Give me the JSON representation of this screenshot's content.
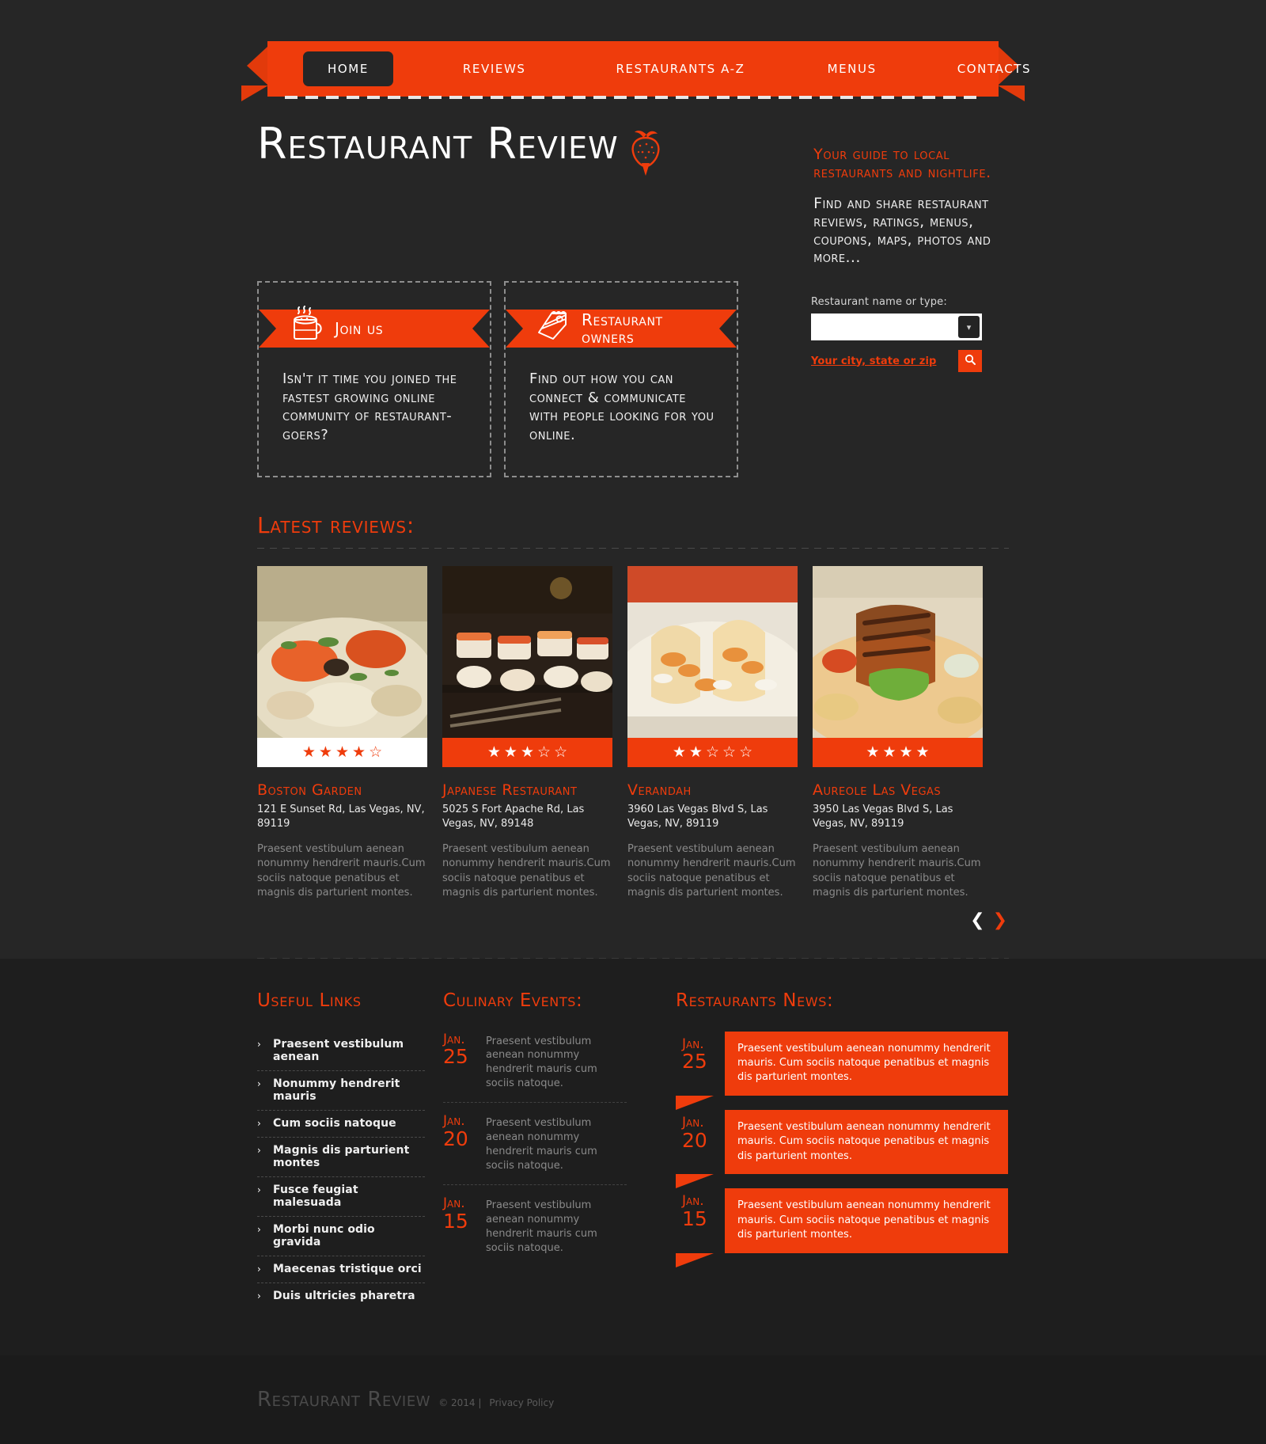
{
  "nav": {
    "items": [
      {
        "label": "HOME",
        "active": true
      },
      {
        "label": "REVIEWS",
        "active": false
      },
      {
        "label": "RESTAURANTS A-Z",
        "active": false
      },
      {
        "label": "MENUS",
        "active": false
      },
      {
        "label": "CONTACTS",
        "active": false
      }
    ]
  },
  "header": {
    "logo": "Restaurant Review",
    "logo_icon": "strawberry-icon",
    "tagline_orange": "Your guide to local restaurants and nightlife.",
    "tagline_white": "Find and share restaurant reviews, ratings, menus, coupons, maps, photos and more..."
  },
  "promos": [
    {
      "icon": "coffee-cup-icon",
      "ribbon_label": "Join us",
      "body": "Isn't it time you joined the fastest growing online community of restaurant-goers?"
    },
    {
      "icon": "cake-slice-icon",
      "ribbon_label": "Restaurant owners",
      "body": "Find out how you can connect & communicate with people looking for you online."
    }
  ],
  "search": {
    "label": "Restaurant name or type:",
    "value": "",
    "placeholder": "",
    "dropdown_icon": "chevron-down-icon",
    "city_link": "Your city, state or zip",
    "submit_icon": "search-icon"
  },
  "reviews": {
    "title": "Latest reviews:",
    "cards": [
      {
        "image": "pasta-seafood-photo",
        "rating_style": "light",
        "rating_filled": 4,
        "rating_total": 5,
        "name": "Boston Garden",
        "address": "121 E Sunset Rd, Las Vegas, NV, 89119",
        "description": "Praesent vestibulum aenean nonummy hendrerit mauris.Cum sociis natoque penatibus et magnis dis parturient montes."
      },
      {
        "image": "sushi-platter-photo",
        "rating_style": "accent",
        "rating_filled": 3,
        "rating_total": 5,
        "name": "Japanese Restaurant",
        "address": "5025 S Fort Apache Rd, Las Vegas, NV, 89148",
        "description": "Praesent vestibulum aenean nonummy hendrerit mauris.Cum sociis natoque penatibus et magnis dis parturient montes."
      },
      {
        "image": "tacos-photo",
        "rating_style": "accent",
        "rating_filled": 2,
        "rating_total": 5,
        "name": "Verandah",
        "address": "3960 Las Vegas Blvd S, Las Vegas, NV, 89119",
        "description": "Praesent vestibulum aenean nonummy hendrerit mauris.Cum sociis natoque penatibus et magnis dis parturient montes."
      },
      {
        "image": "grilled-steak-photo",
        "rating_style": "accent",
        "rating_filled": 4,
        "rating_total": 4,
        "name": "Aureole Las Vegas",
        "address": "3950 Las Vegas Blvd S, Las Vegas, NV, 89119",
        "description": "Praesent vestibulum aenean nonummy hendrerit mauris.Cum sociis natoque penatibus et magnis dis parturient montes."
      }
    ],
    "prev_arrow": "❮",
    "next_arrow": "❯"
  },
  "useful_links": {
    "title": "Useful Links",
    "chevron": "›",
    "items": [
      "Praesent vestibulum aenean",
      "Nonummy hendrerit mauris",
      "Cum sociis natoque",
      "Magnis dis parturient montes",
      "Fusce feugiat malesuada",
      "Morbi nunc odio gravida",
      "Maecenas tristique orci",
      "Duis ultricies pharetra"
    ]
  },
  "culinary_events": {
    "title": "Culinary Events:",
    "items": [
      {
        "month": "Jan.",
        "day": "25",
        "text": "Praesent vestibulum aenean nonummy hendrerit mauris cum sociis natoque."
      },
      {
        "month": "Jan.",
        "day": "20",
        "text": "Praesent vestibulum aenean nonummy hendrerit mauris cum sociis natoque."
      },
      {
        "month": "Jan.",
        "day": "15",
        "text": "Praesent vestibulum aenean nonummy hendrerit mauris cum sociis natoque."
      }
    ]
  },
  "restaurants_news": {
    "title": "Restaurants News:",
    "items": [
      {
        "month": "Jan.",
        "day": "25",
        "text": "Praesent vestibulum aenean nonummy hendrerit mauris. Cum sociis natoque penatibus et magnis dis parturient montes."
      },
      {
        "month": "Jan.",
        "day": "20",
        "text": "Praesent vestibulum aenean nonummy hendrerit mauris. Cum sociis natoque penatibus et magnis dis parturient montes."
      },
      {
        "month": "Jan.",
        "day": "15",
        "text": "Praesent vestibulum aenean nonummy hendrerit mauris. Cum sociis natoque penatibus et magnis dis parturient montes."
      }
    ]
  },
  "footer": {
    "logo": "Restaurant Review",
    "copyright": "© 2014  |  ",
    "privacy": "Privacy Policy"
  },
  "colors": {
    "accent": "#ef3c0c",
    "background": "#212121",
    "panel": "#1e1e1e",
    "text": "#efefef",
    "muted": "#8a8a8a"
  }
}
